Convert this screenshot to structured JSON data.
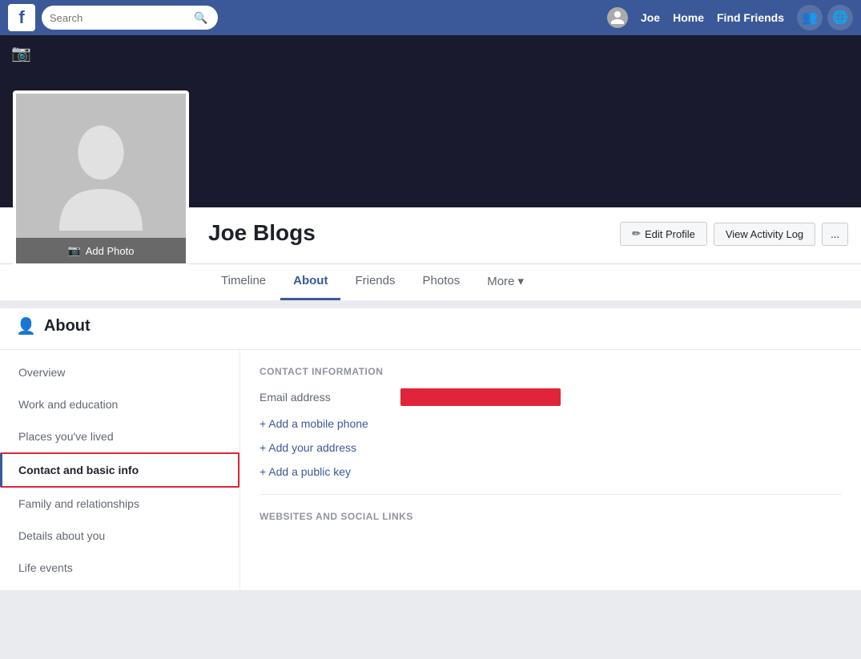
{
  "navbar": {
    "logo": "f",
    "search_placeholder": "Search",
    "user_name": "Joe",
    "home_label": "Home",
    "find_friends_label": "Find Friends"
  },
  "cover": {
    "camera_hint": "Update Cover Photo"
  },
  "profile": {
    "name": "Joe Blogs",
    "add_photo_label": "Add Photo",
    "edit_profile_label": "Edit Profile",
    "activity_log_label": "View Activity Log",
    "more_label": "..."
  },
  "tabs": [
    {
      "label": "Timeline",
      "id": "timeline"
    },
    {
      "label": "About",
      "id": "about",
      "active": true
    },
    {
      "label": "Friends",
      "id": "friends"
    },
    {
      "label": "Photos",
      "id": "photos"
    },
    {
      "label": "More",
      "id": "more",
      "has_arrow": true
    }
  ],
  "about": {
    "title": "About",
    "sidebar_items": [
      {
        "label": "Overview",
        "id": "overview",
        "active": false
      },
      {
        "label": "Work and education",
        "id": "work",
        "active": false
      },
      {
        "label": "Places you've lived",
        "id": "places",
        "active": false
      },
      {
        "label": "Contact and basic info",
        "id": "contact",
        "active": true
      },
      {
        "label": "Family and relationships",
        "id": "family",
        "active": false
      },
      {
        "label": "Details about you",
        "id": "details",
        "active": false
      },
      {
        "label": "Life events",
        "id": "life",
        "active": false
      }
    ],
    "contact_section_label": "CONTACT INFORMATION",
    "email_label": "Email address",
    "add_mobile_label": "+ Add a mobile phone",
    "add_address_label": "+ Add your address",
    "add_key_label": "+ Add a public key",
    "websites_section_label": "WEBSITES AND SOCIAL LINKS"
  }
}
